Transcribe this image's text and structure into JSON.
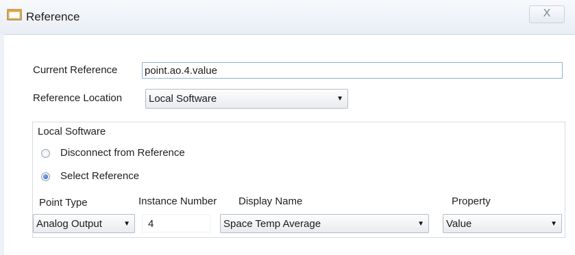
{
  "window": {
    "title": "Reference",
    "close_glyph": "X"
  },
  "fields": {
    "current_reference_label": "Current Reference",
    "current_reference_value": "point.ao.4.value",
    "reference_location_label": "Reference Location",
    "reference_location_value": "Local Software"
  },
  "local_software": {
    "group_title": "Local Software",
    "radio_disconnect_label": "Disconnect from Reference",
    "radio_disconnect_selected": false,
    "radio_select_label": "Select Reference",
    "radio_select_selected": true,
    "point_type_label": "Point Type",
    "point_type_value": "Analog Output",
    "instance_number_label": "Instance Number",
    "instance_number_value": "4",
    "display_name_label": "Display Name",
    "display_name_value": "Space Temp Average",
    "property_label": "Property",
    "property_value": "Value"
  },
  "icons": {
    "window_icon": "window-icon",
    "dropdown_arrow": "▼"
  },
  "colors": {
    "radio_selected": "#1f5fae",
    "text_input_border": "#8fb0d6"
  }
}
